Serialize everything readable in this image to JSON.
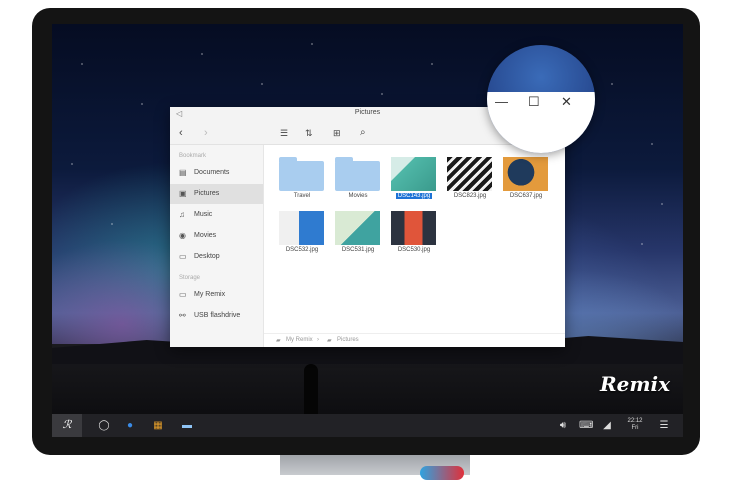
{
  "window": {
    "title": "Pictures",
    "toolbar_icons": [
      "back-arrow-icon",
      "forward-arrow-icon",
      "list-view-icon",
      "sort-icon",
      "new-folder-icon",
      "search-icon"
    ]
  },
  "sidebar": {
    "sections": [
      {
        "label": "Bookmark",
        "items": [
          {
            "label": "Documents",
            "icon": "document-icon"
          },
          {
            "label": "Pictures",
            "icon": "picture-icon",
            "active": true
          },
          {
            "label": "Music",
            "icon": "music-icon"
          },
          {
            "label": "Movies",
            "icon": "movie-icon"
          },
          {
            "label": "Desktop",
            "icon": "desktop-icon"
          }
        ]
      },
      {
        "label": "Storage",
        "items": [
          {
            "label": "My Remix",
            "icon": "monitor-icon"
          },
          {
            "label": "USB flashdrive",
            "icon": "usb-icon"
          }
        ]
      }
    ]
  },
  "files": [
    {
      "name": "Travel",
      "type": "folder"
    },
    {
      "name": "Movies",
      "type": "folder"
    },
    {
      "name": "DSC143.jpg",
      "type": "image",
      "selected": true,
      "colors": [
        "#4fb7a7",
        "#d6ece7"
      ]
    },
    {
      "name": "DSC823.jpg",
      "type": "image",
      "colors": [
        "#1a1a1a",
        "#f2f2f2"
      ]
    },
    {
      "name": "DSC637.jpg",
      "type": "image",
      "colors": [
        "#1f3a5c",
        "#e39a3c"
      ]
    },
    {
      "name": "DSC532.jpg",
      "type": "image",
      "colors": [
        "#2f7bd0",
        "#f0f0f0"
      ]
    },
    {
      "name": "DSC531.jpg",
      "type": "image",
      "colors": [
        "#d9ead4",
        "#3fa3a0"
      ]
    },
    {
      "name": "DSC530.jpg",
      "type": "image",
      "colors": [
        "#2c3340",
        "#e0553a"
      ]
    }
  ],
  "breadcrumb": [
    "My Remix",
    "Pictures"
  ],
  "window_controls": [
    "minimize-icon",
    "maximize-icon",
    "close-icon"
  ],
  "taskbar": {
    "start_logo": "ℛ",
    "apps": [
      "home-icon",
      "browser-icon",
      "app-store-icon",
      "file-manager-icon"
    ],
    "tray_icons": [
      "volume-icon",
      "keyboard-icon",
      "cast-icon"
    ],
    "time": "22:12",
    "day": "Fri",
    "menu_icon": "menu-icon"
  },
  "brand": "Remix",
  "colors": {
    "selection": "#1e73d6",
    "folder": "#a9cdef",
    "taskbar": "#222226"
  }
}
